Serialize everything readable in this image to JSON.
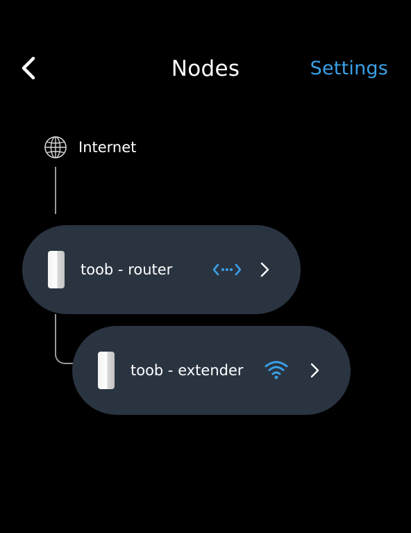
{
  "header": {
    "title": "Nodes",
    "back_icon": "chevron-left-icon",
    "settings_label": "Settings"
  },
  "internet": {
    "label": "Internet",
    "icon": "globe-icon"
  },
  "nodes": [
    {
      "name": "toob - router",
      "device_icon": "router-node-icon",
      "connection_icon": "wired-connection-icon",
      "chevron_icon": "chevron-right-icon"
    },
    {
      "name": "toob - extender",
      "device_icon": "extender-node-icon",
      "connection_icon": "wifi-icon",
      "chevron_icon": "chevron-right-icon"
    }
  ],
  "colors": {
    "background": "#000000",
    "card": "#2a3440",
    "accent": "#3aa0e8",
    "text": "#ffffff",
    "connector": "#9a9a9a"
  }
}
